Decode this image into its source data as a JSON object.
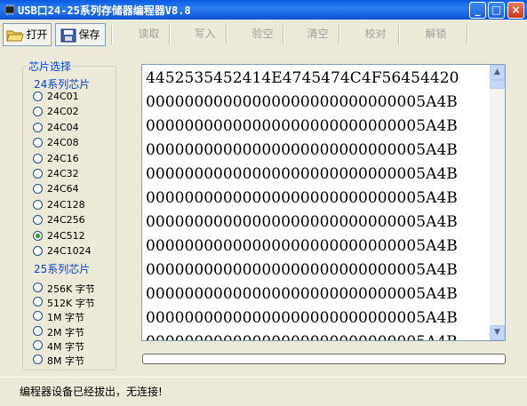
{
  "window": {
    "title": "USB口24-25系列存储器编程器V8.8"
  },
  "toolbar": {
    "open_label": "打开",
    "save_label": "保存",
    "read_label": "读取",
    "write_label": "写入",
    "verify_label": "验空",
    "erase_label": "清空",
    "check_label": "校对",
    "unlock_label": "解锁"
  },
  "chip_select": {
    "title": "芯片选择",
    "series24_title": "24系列芯片",
    "series24": [
      "24C01",
      "24C02",
      "24C04",
      "24C08",
      "24C16",
      "24C32",
      "24C64",
      "24C128",
      "24C256",
      "24C512",
      "24C1024"
    ],
    "selected": "24C512",
    "series25_title": "25系列芯片",
    "series25": [
      "256K 字节",
      "512K 字节",
      "1M 字节",
      "2M 字节",
      "4M 字节",
      "8M 字节"
    ]
  },
  "hex_view": {
    "lines": [
      "4452535452414E4745474C4F56454420",
      "00000000000000000000000000005A4B",
      "00000000000000000000000000005A4B",
      "00000000000000000000000000005A4B",
      "00000000000000000000000000005A4B",
      "00000000000000000000000000005A4B",
      "00000000000000000000000000005A4B",
      "00000000000000000000000000005A4B",
      "00000000000000000000000000005A4B",
      "00000000000000000000000000005A4B",
      "00000000000000000000000000005A4B",
      "00000000000000000000000000005A4B"
    ]
  },
  "progress": {
    "value": 0
  },
  "status": {
    "text": "编程器设备已经拔出，无连接!"
  },
  "colors": {
    "titlebar": "#0a5be0",
    "group_title": "#0046d5",
    "radio_on": "#21a121"
  }
}
